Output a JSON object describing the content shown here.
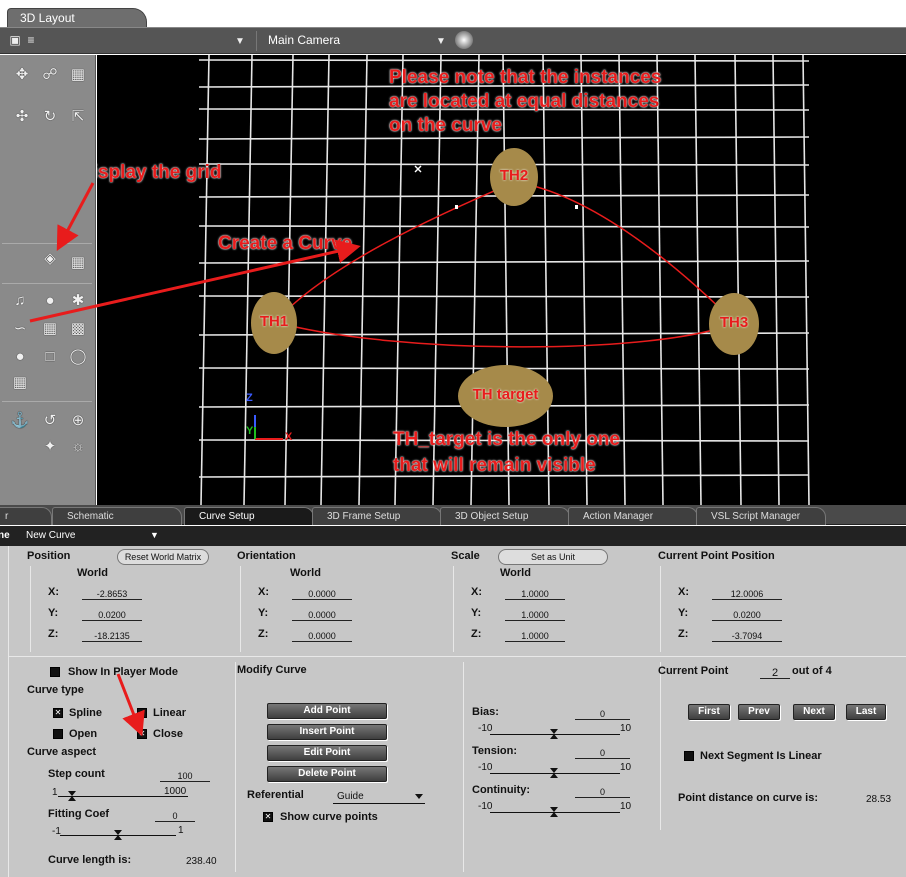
{
  "window": {
    "title": "3D Layout"
  },
  "viewport": {
    "camera": "Main Camera",
    "annotations": {
      "note_line1": "Please note that the instances",
      "note_line2": "are located at equal distances",
      "note_line3": "on the curve",
      "display_grid": "Display the grid",
      "create_curve": "Create a Curve",
      "target_note_line1": "TH_target is the only one",
      "target_note_line2": "that will remain visible"
    },
    "instances": {
      "th1": "TH1",
      "th2": "TH2",
      "th3": "TH3",
      "target": "TH target"
    },
    "axis": {
      "x": "X",
      "y": "Y",
      "z": "Z"
    }
  },
  "panel_tabs": [
    {
      "label": "r"
    },
    {
      "label": "Schematic"
    },
    {
      "label": "Curve Setup"
    },
    {
      "label": "3D Frame Setup"
    },
    {
      "label": "3D Object Setup"
    },
    {
      "label": "Action Manager"
    },
    {
      "label": "VSL Script Manager"
    }
  ],
  "curve_bar": {
    "prefix": "ne",
    "name": "New Curve"
  },
  "position": {
    "title": "Position",
    "reset_button": "Reset World Matrix",
    "space": "World",
    "x_label": "X:",
    "y_label": "Y:",
    "z_label": "Z:",
    "x": "-2.8653",
    "y": "0.0200",
    "z": "-18.2135"
  },
  "orientation": {
    "title": "Orientation",
    "space": "World",
    "x_label": "X:",
    "y_label": "Y:",
    "z_label": "Z:",
    "x": "0.0000",
    "y": "0.0000",
    "z": "0.0000"
  },
  "scale": {
    "title": "Scale",
    "unit_button": "Set as Unit",
    "space": "World",
    "x_label": "X:",
    "y_label": "Y:",
    "z_label": "Z:",
    "x": "1.0000",
    "y": "1.0000",
    "z": "1.0000"
  },
  "current_point_position": {
    "title": "Current Point Position",
    "x_label": "X:",
    "y_label": "Y:",
    "z_label": "Z:",
    "x": "12.0006",
    "y": "0.0200",
    "z": "-3.7094"
  },
  "curve_options": {
    "show_player": "Show In Player Mode",
    "curve_type": "Curve type",
    "spline": "Spline",
    "linear": "Linear",
    "open": "Open",
    "close": "Close",
    "curve_aspect": "Curve aspect",
    "step_count_label": "Step count",
    "step_count": "100",
    "step_min": "1",
    "step_max": "1000",
    "fitting_label": "Fitting Coef",
    "fitting": "0",
    "fit_min": "-1",
    "fit_max": "1",
    "length_label": "Curve length is:",
    "length": "238.40"
  },
  "modify": {
    "title": "Modify Curve",
    "add": "Add Point",
    "insert": "Insert Point",
    "edit": "Edit Point",
    "delete": "Delete Point",
    "referential_label": "Referential",
    "referential": "Guide",
    "show_points": "Show curve points"
  },
  "params": {
    "bias_label": "Bias:",
    "bias": "0",
    "tension_label": "Tension:",
    "tension": "0",
    "continuity_label": "Continuity:",
    "continuity": "0",
    "min": "-10",
    "max": "10"
  },
  "current_point": {
    "label": "Current Point",
    "value": "2",
    "out_of": "out of 4",
    "first": "First",
    "prev": "Prev",
    "next": "Next",
    "last": "Last",
    "next_linear": "Next Segment Is Linear",
    "distance_label": "Point distance on curve is:",
    "distance": "28.53"
  },
  "colors": {
    "annotation": "#e81c1c",
    "instance": "#a68a4a",
    "panel_bg": "#c7c7c7",
    "viewport_bg": "#000000"
  }
}
